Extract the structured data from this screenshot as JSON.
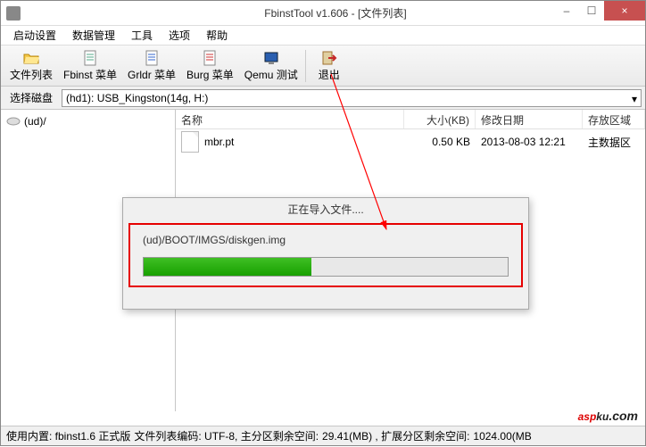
{
  "window": {
    "title": "FbinstTool v1.606 - [文件列表]",
    "controls": {
      "min": "–",
      "max": "☐",
      "close": "×"
    }
  },
  "menu": {
    "items": [
      "启动设置",
      "数据管理",
      "工具",
      "选项",
      "帮助"
    ]
  },
  "toolbar": {
    "buttons": [
      "文件列表",
      "Fbinst 菜单",
      "Grldr 菜单",
      "Burg 菜单",
      "Qemu 测试",
      "退出"
    ]
  },
  "diskrow": {
    "label": "选择磁盘",
    "value": "(hd1): USB_Kingston(14g, H:)"
  },
  "tree": {
    "root": "(ud)/"
  },
  "list": {
    "headers": {
      "name": "名称",
      "size": "大小(KB)",
      "date": "修改日期",
      "area": "存放区域"
    },
    "rows": [
      {
        "name": "mbr.pt",
        "size": "0.50 KB",
        "date": "2013-08-03 12:21",
        "area": "主数据区"
      }
    ]
  },
  "dialog": {
    "title": "正在导入文件....",
    "path": "(ud)/BOOT/IMGS/diskgen.img",
    "progress_pct": 46
  },
  "status": {
    "seg1": "使用内置: fbinst1.6 正式版",
    "seg2": "文件列表编码: UTF-8, 主分区剩余空间:",
    "seg3": "29.41(MB) , 扩展分区剩余空间:",
    "seg4": "1024.00(MB"
  },
  "watermark": {
    "a": "asp",
    "b": "ku",
    "c": ".com"
  }
}
